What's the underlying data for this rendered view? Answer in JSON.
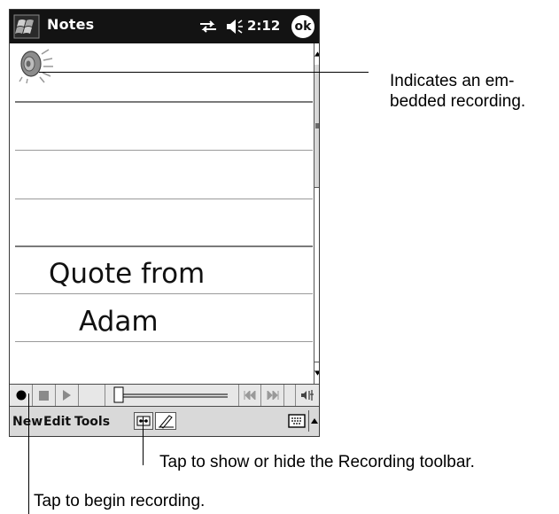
{
  "titlebar": {
    "start_icon": "windows-flag-icon",
    "app_title": "Notes",
    "connectivity_icon": "connectivity-icon",
    "volume_icon": "speaker-icon",
    "clock": "2:12",
    "ok_label": "ok"
  },
  "note": {
    "embedded_recording_icon": "speaker-recording-icon",
    "ink_lines": [
      "Quote from",
      "Adam"
    ]
  },
  "recording_toolbar": {
    "buttons": [
      "record-icon",
      "stop-icon",
      "play-icon",
      "slider",
      "skip-back-icon",
      "skip-forward-icon",
      "volume-icon"
    ]
  },
  "menubar": {
    "new_label": "New",
    "edit_label": "Edit",
    "tools_label": "Tools",
    "recording_toggle_icon": "cassette-icon",
    "pen_icon": "pen-icon",
    "keyboard_icon": "keyboard-icon"
  },
  "callouts": {
    "embedded_recording_line1": "Indicates an em-",
    "embedded_recording_line2": "bedded recording.",
    "recording_toolbar": "Tap to show or hide the Recording toolbar.",
    "begin_recording": "Tap to begin recording."
  },
  "colors": {
    "titlebar_bg": "#131313",
    "toolbar_bg": "#e7e7e7",
    "menubar_bg": "#d9d9d9"
  }
}
